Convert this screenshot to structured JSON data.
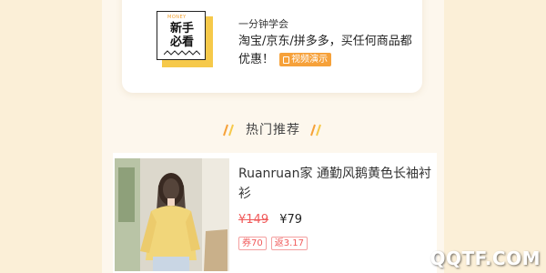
{
  "tutorial": {
    "badge_small": "MONEY",
    "badge_line1": "新手",
    "badge_line2": "必看",
    "subtitle": "一分钟学会",
    "headline": "淘宝/京东/拼多多，买任何商品都优惠！",
    "video_tag": "视频演示"
  },
  "section": {
    "title": "热门推荐"
  },
  "product": {
    "name": "Ruanruan家 通勤风鹅黄色长袖衬衫",
    "original_price": "¥149",
    "price": "¥79",
    "tags": [
      "券70",
      "返3.17"
    ]
  },
  "watermark": "QQTF.COM",
  "colors": {
    "background": "#fbeedd",
    "accent_orange": "#f6a13a",
    "price_red": "#f05a5a",
    "badge_yellow": "#f6c94a"
  }
}
